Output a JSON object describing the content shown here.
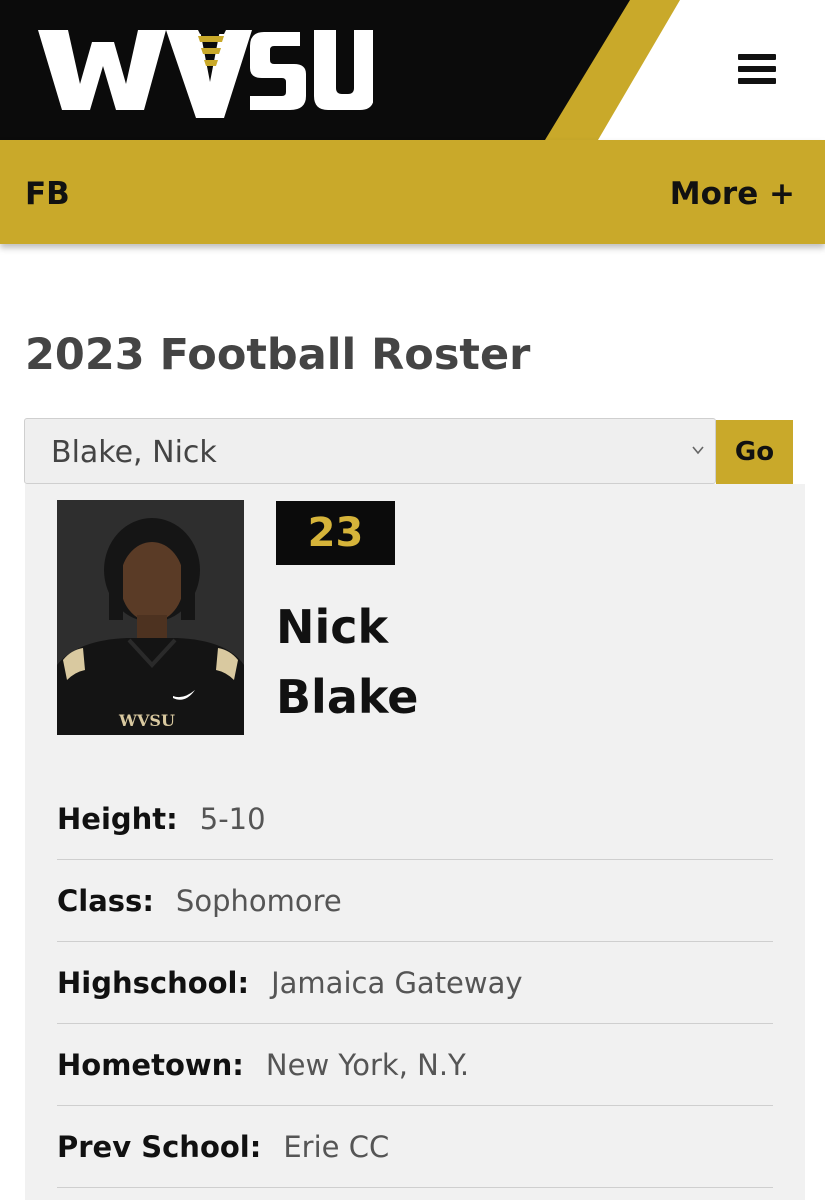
{
  "header": {
    "logo_text": "WVSU",
    "menu_icon": "hamburger-menu-icon",
    "colors": {
      "black": "#0b0b0b",
      "gold": "#c9a92a",
      "white": "#ffffff"
    }
  },
  "subnav": {
    "sport": "FB",
    "more_label": "More +"
  },
  "page": {
    "title": "2023 Football Roster"
  },
  "roster_select": {
    "selected": "Blake, Nick",
    "go_label": "Go"
  },
  "player": {
    "number": "23",
    "first_name": "Nick",
    "last_name": "Blake",
    "jersey_text": "WVSU",
    "details": [
      {
        "label": "Height:",
        "value": "5-10"
      },
      {
        "label": "Class:",
        "value": "Sophomore"
      },
      {
        "label": "Highschool:",
        "value": "Jamaica Gateway"
      },
      {
        "label": "Hometown:",
        "value": "New York, N.Y."
      },
      {
        "label": "Prev School:",
        "value": "Erie CC"
      }
    ]
  }
}
